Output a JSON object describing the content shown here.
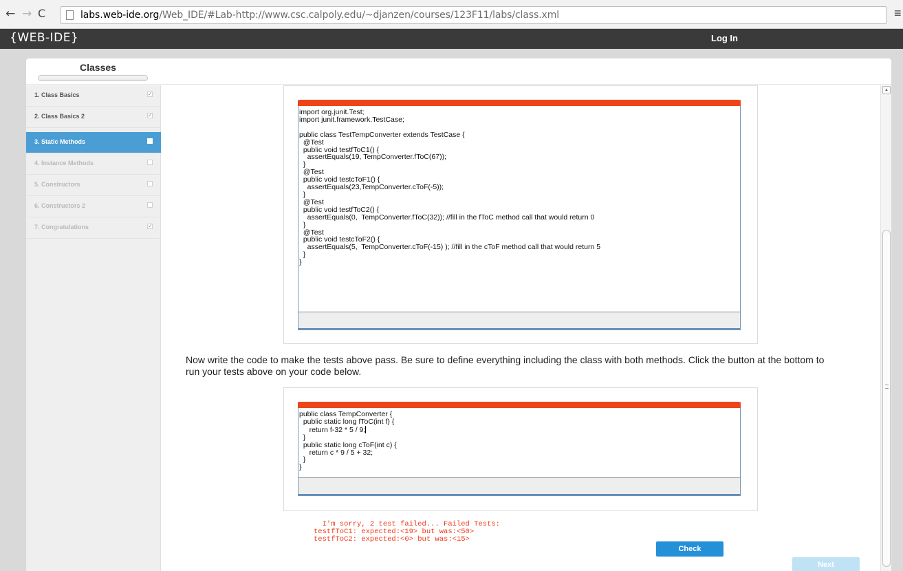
{
  "browser": {
    "back_glyph": "←",
    "forward_glyph": "→",
    "reload_glyph": "C",
    "url_host": "labs.web-ide.org",
    "url_rest": "/Web_IDE/#Lab-http://www.csc.calpoly.edu/~djanzen/courses/123F11/labs/class.xml",
    "menu_glyph": "≡"
  },
  "header": {
    "logo": "{WEB-IDE}",
    "login_label": "Log In"
  },
  "panel": {
    "title": "Classes"
  },
  "sidebar": {
    "items": [
      {
        "label": "1. Class Basics",
        "check": "✓",
        "state": "done"
      },
      {
        "label": "2. Class Basics 2",
        "check": "✓",
        "state": "done"
      },
      {
        "label": "3. Static Methods",
        "check": "",
        "state": "active"
      },
      {
        "label": "4. Instance Methods",
        "check": "",
        "state": "disabled"
      },
      {
        "label": "5. Constructors",
        "check": "",
        "state": "disabled"
      },
      {
        "label": "6. Constructors 2",
        "check": "",
        "state": "disabled"
      },
      {
        "label": "7. Congratulations",
        "check": "✓",
        "state": "disabled"
      }
    ]
  },
  "test_editor": {
    "code": "import org.junit.Test;\nimport junit.framework.TestCase;\n\npublic class TestTempConverter extends TestCase {\n  @Test\n  public void testfToC1() {\n    assertEquals(19, TempConverter.fToC(67));\n  }\n  @Test\n  public void testcToF1() {\n    assertEquals(23,TempConverter.cToF(-5));\n  }\n  @Test\n  public void testfToC2() {\n    assertEquals(0,  TempConverter.fToC(32)); //fill in the fToC method call that would return 0\n  }\n  @Test\n  public void testcToF2() {\n    assertEquals(5,  TempConverter.cToF(-15) ); //fill in the cToF method call that would return 5\n  }\n}"
  },
  "instructions": "Now write the code to make the tests above pass. Be sure to define everything including the class with both methods. Click the button at the bottom to run your tests above on your code below.",
  "solution_editor": {
    "code_before_caret": "public class TempConverter {\n  public static long fToC(int f) {\n     return f-32 * 5 / 9;",
    "code_after_caret": "\n  }\n  public static long cToF(int c) {\n     return c * 9 / 5 + 32;\n  }\n}"
  },
  "result": {
    "message": "  I'm sorry, 2 test failed... Failed Tests:\ntestfToC1: expected:<19> but was:<50>\ntestfToC2: expected:<0> but was:<15>"
  },
  "buttons": {
    "check_label": "Check",
    "next_label": "Next"
  },
  "colors": {
    "accent": "#4a9ed4",
    "editor_bar": "#ef4318",
    "error_text": "#ef3b1a",
    "check_button": "#2490d8"
  }
}
